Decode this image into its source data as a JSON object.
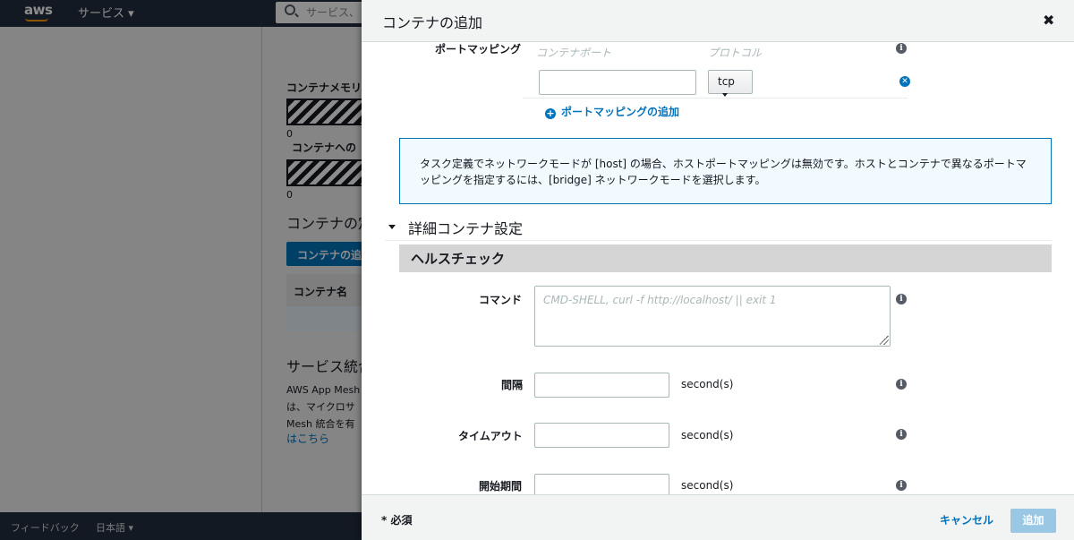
{
  "background": {
    "nav": {
      "logo": "aws",
      "services": "サービス ▾",
      "search_placeholder": "サービス、"
    },
    "labels": {
      "container_memory": "コンテナメモリ",
      "container_to": "コンテナへの",
      "zero_1": "0",
      "zero_2": "0",
      "container_heading": "コンテナの定",
      "add_container_btn": "コンテナの追加",
      "container_name_col": "コンテナ名",
      "service_heading": "サービス統合",
      "body_line1": "AWS App Mesh",
      "body_line2": "は、マイクロサ",
      "body_line3": "Mesh 統合を有",
      "link": "はこちら"
    },
    "footer": {
      "feedback": "フィードバック",
      "language": "日本語 ▾"
    }
  },
  "panel": {
    "title": "コンテナの追加",
    "close_symbol": "✖",
    "port_mapping": {
      "label": "ポートマッピング",
      "col_container_port": "コンテナポート",
      "col_protocol": "プロトコル",
      "container_port_value": "",
      "protocol_value": "tcp",
      "add_link": "ポートマッピングの追加",
      "remove_symbol": "✕",
      "add_symbol": "+"
    },
    "info_box_text": "タスク定義でネットワークモードが [host] の場合、ホストポートマッピングは無効です。ホストとコンテナで異なるポートマッピングを指定するには、[bridge] ネットワークモードを選択します。",
    "advanced_section": "詳細コンテナ設定",
    "health_check": {
      "title": "ヘルスチェック",
      "command_label": "コマンド",
      "command_placeholder": "CMD-SHELL, curl -f http://localhost/ || exit 1",
      "interval_label": "間隔",
      "interval_unit": "second(s)",
      "timeout_label": "タイムアウト",
      "timeout_unit": "second(s)",
      "start_period_label": "開始期間",
      "start_period_unit": "second(s)"
    },
    "info_symbol": "i",
    "footer": {
      "required": "* 必須",
      "cancel": "キャンセル",
      "add": "追加"
    }
  }
}
